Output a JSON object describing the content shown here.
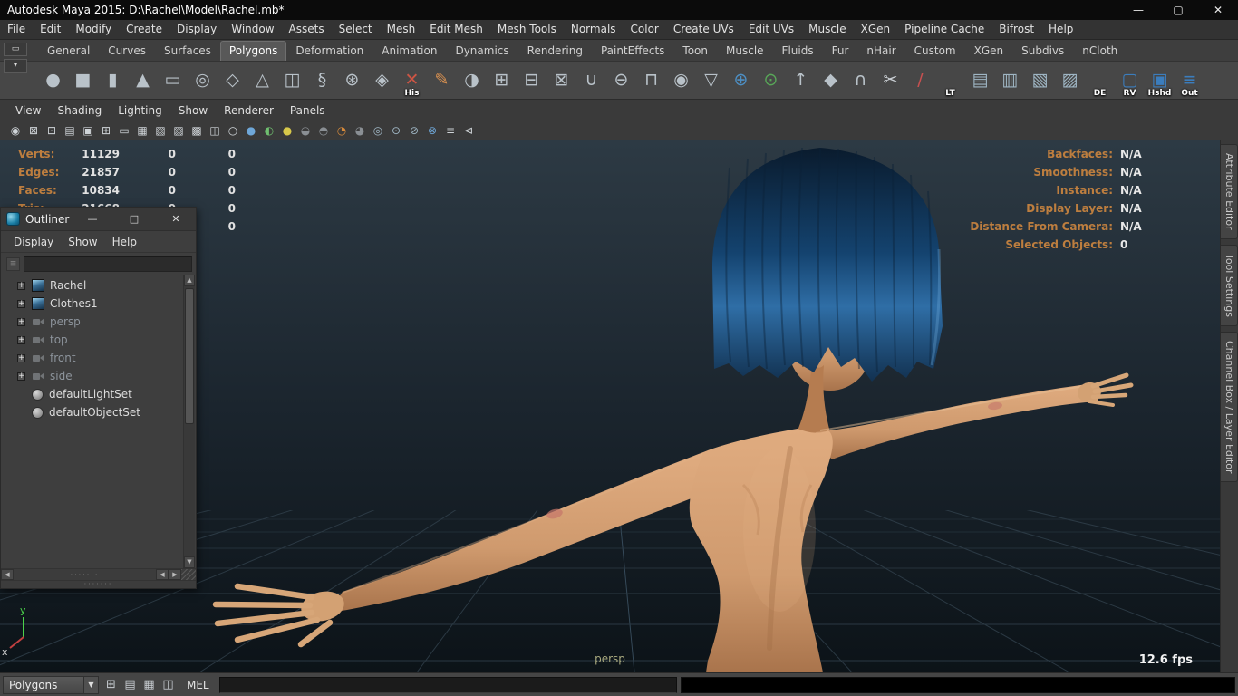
{
  "title_bar": {
    "title": "Autodesk Maya 2015: D:\\Rachel\\Model\\Rachel.mb*",
    "controls": {
      "minimize": "—",
      "maximize": "▢",
      "close": "✕"
    }
  },
  "menu_bar": {
    "items": [
      {
        "label": "File"
      },
      {
        "label": "Edit"
      },
      {
        "label": "Modify"
      },
      {
        "label": "Create"
      },
      {
        "label": "Display"
      },
      {
        "label": "Window"
      },
      {
        "label": "Assets"
      },
      {
        "label": "Select"
      },
      {
        "label": "Mesh"
      },
      {
        "label": "Edit Mesh"
      },
      {
        "label": "Mesh Tools"
      },
      {
        "label": "Normals"
      },
      {
        "label": "Color"
      },
      {
        "label": "Create UVs"
      },
      {
        "label": "Edit UVs"
      },
      {
        "label": "Muscle"
      },
      {
        "label": "XGen"
      },
      {
        "label": "Pipeline Cache"
      },
      {
        "label": "Bifrost"
      },
      {
        "label": "Help"
      }
    ]
  },
  "shelf": {
    "controls": [
      {
        "name": "shelf-tab-menu-button",
        "glyph": "▭"
      },
      {
        "name": "shelf-menu-button",
        "glyph": "▾"
      }
    ],
    "tabs": [
      {
        "label": "General"
      },
      {
        "label": "Curves"
      },
      {
        "label": "Surfaces"
      },
      {
        "label": "Polygons",
        "state": "active"
      },
      {
        "label": "Deformation"
      },
      {
        "label": "Animation"
      },
      {
        "label": "Dynamics"
      },
      {
        "label": "Rendering"
      },
      {
        "label": "PaintEffects"
      },
      {
        "label": "Toon"
      },
      {
        "label": "Muscle"
      },
      {
        "label": "Fluids"
      },
      {
        "label": "Fur"
      },
      {
        "label": "nHair"
      },
      {
        "label": "Custom"
      },
      {
        "label": "XGen"
      },
      {
        "label": "Subdivs"
      },
      {
        "label": "nCloth"
      }
    ],
    "icons": [
      {
        "name": "poly-sphere-icon",
        "glyph": "●",
        "color": "#b9c2c9",
        "label": ""
      },
      {
        "name": "poly-cube-icon",
        "glyph": "■",
        "color": "#b9c2c9",
        "label": ""
      },
      {
        "name": "poly-cylinder-icon",
        "glyph": "▮",
        "color": "#b9c2c9",
        "label": ""
      },
      {
        "name": "poly-cone-icon",
        "glyph": "▲",
        "color": "#b9c2c9",
        "label": ""
      },
      {
        "name": "poly-plane-icon",
        "glyph": "▭",
        "color": "#b9c2c9",
        "label": ""
      },
      {
        "name": "poly-torus-icon",
        "glyph": "◎",
        "color": "#b9c2c9",
        "label": ""
      },
      {
        "name": "poly-prism-icon",
        "glyph": "◇",
        "color": "#b9c2c9",
        "label": ""
      },
      {
        "name": "poly-pyramid-icon",
        "glyph": "△",
        "color": "#b9c2c9",
        "label": ""
      },
      {
        "name": "poly-pipe-icon",
        "glyph": "◫",
        "color": "#b9c2c9",
        "label": ""
      },
      {
        "name": "poly-helix-icon",
        "glyph": "§",
        "color": "#b9c2c9",
        "label": ""
      },
      {
        "name": "poly-soccerball-icon",
        "glyph": "⊛",
        "color": "#b9c2c9",
        "label": ""
      },
      {
        "name": "poly-platonic-icon",
        "glyph": "◈",
        "color": "#b9c2c9",
        "label": ""
      },
      {
        "name": "construction-history-icon",
        "glyph": "✕",
        "color": "#cc5544",
        "label": "His"
      },
      {
        "name": "sculpt-tool-icon",
        "glyph": "✎",
        "color": "#d89050",
        "label": ""
      },
      {
        "name": "mirror-icon",
        "glyph": "◑",
        "color": "#b9c2c9",
        "label": ""
      },
      {
        "name": "combine-icon",
        "glyph": "⊞",
        "color": "#b9c2c9",
        "label": ""
      },
      {
        "name": "separate-icon",
        "glyph": "⊟",
        "color": "#b9c2c9",
        "label": ""
      },
      {
        "name": "extract-icon",
        "glyph": "⊠",
        "color": "#b9c2c9",
        "label": ""
      },
      {
        "name": "boolean-union-icon",
        "glyph": "∪",
        "color": "#b9c2c9",
        "label": ""
      },
      {
        "name": "boolean-difference-icon",
        "glyph": "⊖",
        "color": "#b9c2c9",
        "label": ""
      },
      {
        "name": "boolean-intersection-icon",
        "glyph": "⊓",
        "color": "#b9c2c9",
        "label": ""
      },
      {
        "name": "smooth-icon",
        "glyph": "◉",
        "color": "#b9c2c9",
        "label": ""
      },
      {
        "name": "reduce-icon",
        "glyph": "▽",
        "color": "#b9c2c9",
        "label": ""
      },
      {
        "name": "wireframe-sphere-icon",
        "glyph": "⊕",
        "color": "#4d8fc4",
        "label": ""
      },
      {
        "name": "shaded-sphere-icon",
        "glyph": "⊙",
        "color": "#58a758",
        "label": ""
      },
      {
        "name": "extrude-icon",
        "glyph": "↑",
        "color": "#b9c2c9",
        "label": ""
      },
      {
        "name": "bevel-icon",
        "glyph": "◆",
        "color": "#b9c2c9",
        "label": ""
      },
      {
        "name": "bridge-icon",
        "glyph": "∩",
        "color": "#b9c2c9",
        "label": ""
      },
      {
        "name": "multi-cut-icon",
        "glyph": "✂",
        "color": "#c9ced3",
        "label": ""
      },
      {
        "name": "paint-effects-icon",
        "glyph": "/",
        "color": "#c75050",
        "label": ""
      },
      {
        "name": "lt-icon",
        "glyph": "",
        "color": "#e0e0e0",
        "label": "LT"
      },
      {
        "name": "uv-planar-icon",
        "glyph": "▤",
        "color": "#9fb6c4",
        "label": ""
      },
      {
        "name": "uv-automatic-icon",
        "glyph": "▥",
        "color": "#9fb6c4",
        "label": ""
      },
      {
        "name": "uv-cut-icon",
        "glyph": "▧",
        "color": "#9fb6c4",
        "label": ""
      },
      {
        "name": "uv-sew-icon",
        "glyph": "▨",
        "color": "#9fb6c4",
        "label": ""
      },
      {
        "name": "xgen-description-icon",
        "glyph": "",
        "color": "#d8c84a",
        "label": "DE"
      },
      {
        "name": "render-view-icon",
        "glyph": "▢",
        "color": "#3b7dbd",
        "label": "RV"
      },
      {
        "name": "hypershade-icon",
        "glyph": "▣",
        "color": "#3b7dbd",
        "label": "Hshd"
      },
      {
        "name": "outliner-icon",
        "glyph": "≡",
        "color": "#3b7dbd",
        "label": "Out"
      }
    ]
  },
  "panel_menu": {
    "items": [
      {
        "label": "View"
      },
      {
        "label": "Shading"
      },
      {
        "label": "Lighting"
      },
      {
        "label": "Show"
      },
      {
        "label": "Renderer"
      },
      {
        "label": "Panels"
      }
    ]
  },
  "panel_toolbar": {
    "icons": [
      {
        "name": "camera-select-icon",
        "glyph": "◉",
        "color": "#cfd4d8"
      },
      {
        "name": "camera-lock-icon",
        "glyph": "⊠",
        "color": "#cfd4d8"
      },
      {
        "name": "camera-attributes-icon",
        "glyph": "⊡",
        "color": "#cfd4d8"
      },
      {
        "name": "bookmarks-icon",
        "glyph": "▤",
        "color": "#cfd4d8"
      },
      {
        "name": "image-plane-icon",
        "glyph": "▣",
        "color": "#cfd4d8"
      },
      {
        "name": "view-grid-icon",
        "glyph": "⊞",
        "color": "#cfd4d8"
      },
      {
        "name": "film-gate-icon",
        "glyph": "▭",
        "color": "#cfd4d8"
      },
      {
        "name": "resolution-gate-icon",
        "glyph": "▦",
        "color": "#cfd4d8"
      },
      {
        "name": "gate-mask-icon",
        "glyph": "▧",
        "color": "#cfd4d8"
      },
      {
        "name": "field-chart-icon",
        "glyph": "▨",
        "color": "#cfd4d8"
      },
      {
        "name": "safe-action-icon",
        "glyph": "▩",
        "color": "#cfd4d8"
      },
      {
        "name": "safe-title-icon",
        "glyph": "◫",
        "color": "#cfd4d8"
      },
      {
        "name": "wireframe-mode-icon",
        "glyph": "○",
        "color": "#cfd4d8"
      },
      {
        "name": "shaded-mode-icon",
        "glyph": "●",
        "color": "#6fa7d8"
      },
      {
        "name": "textured-mode-icon",
        "glyph": "◐",
        "color": "#6fbf6f"
      },
      {
        "name": "use-all-lights-icon",
        "glyph": "●",
        "color": "#d8c84a"
      },
      {
        "name": "shadows-icon",
        "glyph": "◒",
        "color": "#8a8f94"
      },
      {
        "name": "screen-ao-icon",
        "glyph": "◓",
        "color": "#8a8f94"
      },
      {
        "name": "motion-blur-icon",
        "glyph": "◔",
        "color": "#d88a3a"
      },
      {
        "name": "multisample-icon",
        "glyph": "◕",
        "color": "#8a8f94"
      },
      {
        "name": "xray-icon",
        "glyph": "◎",
        "color": "#9fb6c4"
      },
      {
        "name": "isolate-select-icon",
        "glyph": "⊙",
        "color": "#9fb6c4"
      },
      {
        "name": "plugin-shading-icon",
        "glyph": "⊘",
        "color": "#9fb6c4"
      },
      {
        "name": "texture-placement-icon",
        "glyph": "⊗",
        "color": "#6fa7d8"
      },
      {
        "name": "hud-toggle-icon",
        "glyph": "≡",
        "color": "#cfd4d8"
      },
      {
        "name": "share-view-icon",
        "glyph": "⊲",
        "color": "#cfd4d8"
      }
    ]
  },
  "hud_left": {
    "rows": [
      {
        "label": "Verts:",
        "c1": "11129",
        "c2": "0",
        "c3": "0"
      },
      {
        "label": "Edges:",
        "c1": "21857",
        "c2": "0",
        "c3": "0"
      },
      {
        "label": "Faces:",
        "c1": "10834",
        "c2": "0",
        "c3": "0"
      },
      {
        "label": "Tris:",
        "c1": "21668",
        "c2": "0",
        "c3": "0"
      },
      {
        "label": "",
        "c1": "",
        "c2": "",
        "c3": "0"
      }
    ]
  },
  "hud_right": {
    "rows": [
      {
        "label": "Backfaces:",
        "value": "N/A"
      },
      {
        "label": "Smoothness:",
        "value": "N/A"
      },
      {
        "label": "Instance:",
        "value": "N/A"
      },
      {
        "label": "Display Layer:",
        "value": "N/A"
      },
      {
        "label": "Distance From Camera:",
        "value": "N/A"
      },
      {
        "label": "Selected Objects:",
        "value": "0"
      }
    ]
  },
  "viewport": {
    "camera_label": "persp",
    "fps": "12.6 fps",
    "axis_y": "y",
    "axis_x": "x"
  },
  "outliner": {
    "title": "Outliner",
    "controls": {
      "minimize": "—",
      "maximize": "□",
      "close": "✕"
    },
    "menus": [
      {
        "label": "Display"
      },
      {
        "label": "Show"
      },
      {
        "label": "Help"
      }
    ],
    "search_value": "",
    "items": [
      {
        "label": "Rachel",
        "icon": "icon-transform",
        "exp": "+",
        "state": ""
      },
      {
        "label": "Clothes1",
        "icon": "icon-transform",
        "exp": "+",
        "state": ""
      },
      {
        "label": "persp",
        "icon": "icon-camera",
        "exp": "+",
        "state": "dim"
      },
      {
        "label": "top",
        "icon": "icon-camera",
        "exp": "+",
        "state": "dim"
      },
      {
        "label": "front",
        "icon": "icon-camera",
        "exp": "+",
        "state": "dim"
      },
      {
        "label": "side",
        "icon": "icon-camera",
        "exp": "+",
        "state": "dim"
      },
      {
        "label": "defaultLightSet",
        "icon": "icon-set",
        "exp": "",
        "state": ""
      },
      {
        "label": "defaultObjectSet",
        "icon": "icon-set",
        "exp": "",
        "state": ""
      }
    ],
    "scrollbar": {
      "up": "▲",
      "down": "▼",
      "left": "◀",
      "right": "▶",
      "grip": "·······"
    }
  },
  "right_tabs": {
    "items": [
      {
        "label": "Attribute Editor"
      },
      {
        "label": "Tool Settings"
      },
      {
        "label": "Channel Box / Layer Editor"
      }
    ]
  },
  "bottom_bar": {
    "menuset": "Polygons",
    "dropdown_arrow": "▼",
    "icons": [
      {
        "name": "grid-snap-icon",
        "glyph": "⊞"
      },
      {
        "name": "quick-layout-list-icon",
        "glyph": "▤"
      },
      {
        "name": "quick-layout-grid-icon",
        "glyph": "▦"
      },
      {
        "name": "quick-layout-split-icon",
        "glyph": "◫"
      }
    ],
    "mel_label": "MEL",
    "command_value": ""
  }
}
